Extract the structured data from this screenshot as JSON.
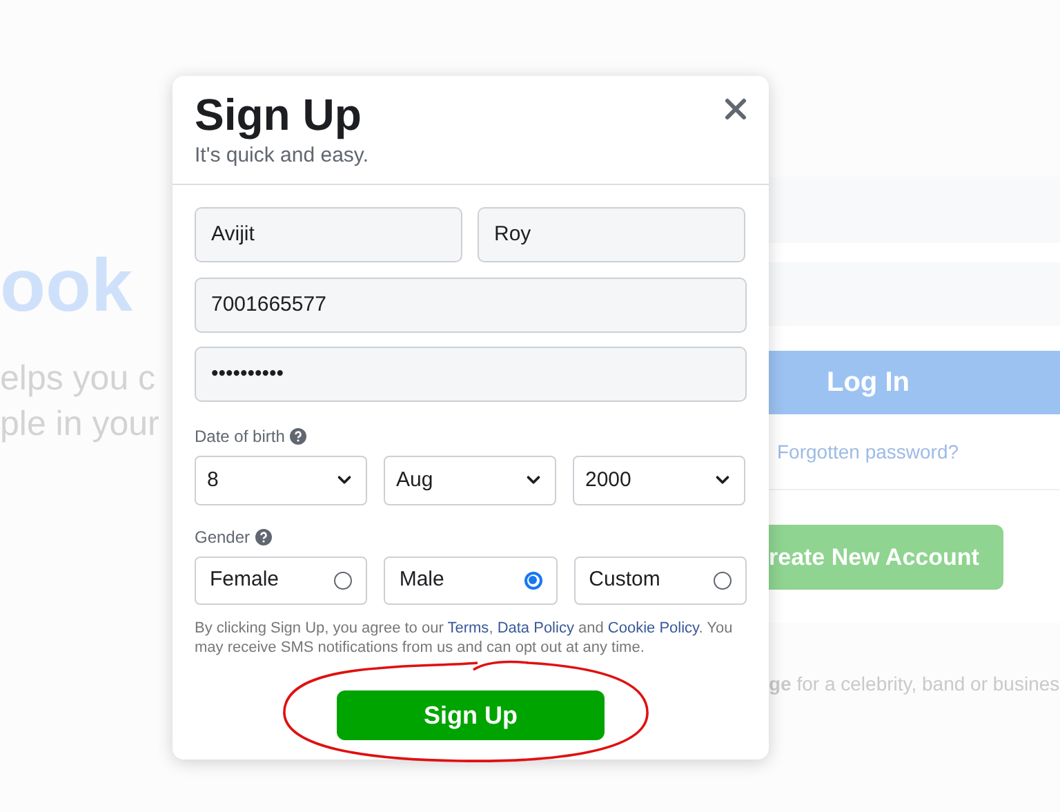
{
  "background": {
    "headline": "ook",
    "tagline_lines": [
      "elps you c",
      "ple in your"
    ],
    "login": {
      "button": "Log In",
      "forgot_link": "Forgotten password?",
      "create_button": "reate New Account"
    },
    "page_note": "**ge** for a celebrity, band or busines"
  },
  "modal": {
    "title": "Sign Up",
    "subtitle": "It's quick and easy.",
    "name_fields": [
      {
        "value": "Avijit"
      },
      {
        "value": "Roy"
      }
    ],
    "contact_field": {
      "value": "7001665577"
    },
    "password_field": {
      "value": "••••••••••"
    },
    "dob": {
      "label": "Date of birth",
      "selects": [
        {
          "value": "8"
        },
        {
          "value": "Aug"
        },
        {
          "value": "2000"
        }
      ]
    },
    "gender": {
      "label": "Gender",
      "options": [
        {
          "label": "Female",
          "selected": false
        },
        {
          "label": "Male",
          "selected": true
        },
        {
          "label": "Custom",
          "selected": false
        }
      ]
    },
    "terms": [
      {
        "text": "By clicking Sign Up, you agree to our ",
        "kind": "text"
      },
      {
        "text": "Terms",
        "kind": "link"
      },
      {
        "text": ", ",
        "kind": "text"
      },
      {
        "text": "Data Policy",
        "kind": "link"
      },
      {
        "text": " and ",
        "kind": "text"
      },
      {
        "text": "Cookie Policy",
        "kind": "link"
      },
      {
        "text": ". You may receive SMS notifications from us and can opt out at any time.",
        "kind": "text"
      }
    ],
    "submit": "Sign Up"
  }
}
